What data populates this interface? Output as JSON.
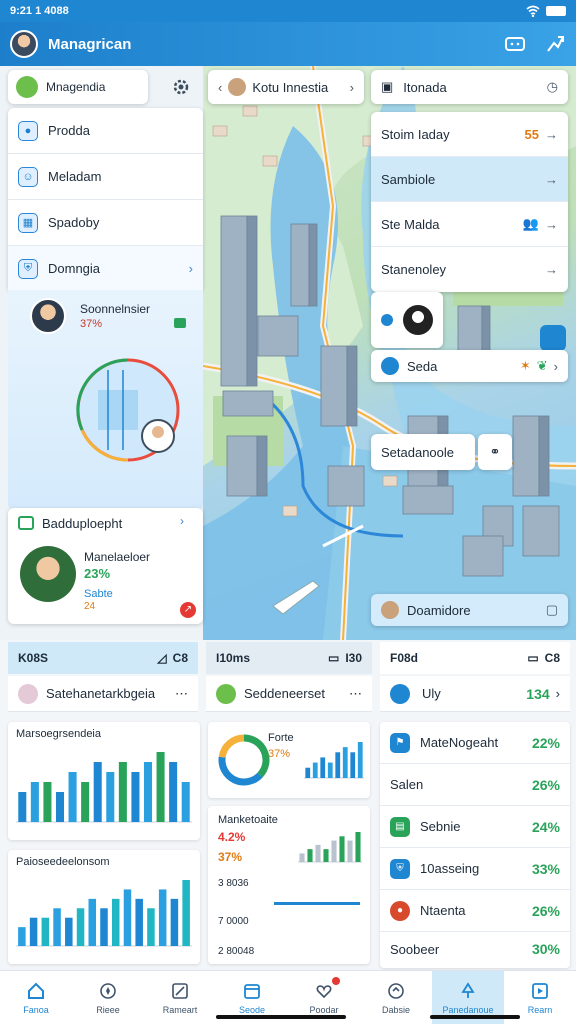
{
  "status": {
    "time": "9:21 1 4088",
    "battery_icon": "battery-icon",
    "wifi_icon": "wifi-icon"
  },
  "appbar": {
    "title": "Managrican",
    "actions": [
      "message-icon",
      "share-icon"
    ]
  },
  "left": {
    "header": "Mnagendia",
    "items": [
      {
        "label": "Prodda",
        "icon": "circle-icon"
      },
      {
        "label": "Meladam",
        "icon": "person-icon"
      },
      {
        "label": "Spadoby",
        "icon": "grid-icon"
      },
      {
        "label": "Domngia",
        "icon": "shield-icon"
      }
    ],
    "person": {
      "name": "Soonnelnsier",
      "stat": "37%"
    },
    "stat_card": {
      "title": "Badduploepht",
      "name": "Manelaeloer",
      "percent": "23%",
      "sub": "Sabte",
      "sub_value": "24"
    }
  },
  "map": {
    "tabs": {
      "left": "Kotu Innestia",
      "right": "Itonada"
    },
    "list": [
      {
        "label": "Stoim Iaday",
        "value": "55"
      },
      {
        "label": "Sambiole",
        "value": ""
      },
      {
        "label": "Ste Malda",
        "value": ""
      },
      {
        "label": "Stanenoley",
        "value": ""
      }
    ],
    "pin_card": {
      "label": "Seda"
    },
    "callout": {
      "label": "Setadanoole"
    },
    "bottom_card": {
      "label": "Doamidore"
    }
  },
  "bottom": {
    "tabs": [
      {
        "label": "K08S",
        "right": "C8"
      },
      {
        "label": "I10ms",
        "right": "I30"
      },
      {
        "label": "F08d",
        "right": "C8"
      }
    ],
    "subs": [
      {
        "label": "Satehanetarkbgeia"
      },
      {
        "label": "Seddeneerset"
      },
      {
        "label": "Uly",
        "value": "134"
      }
    ],
    "chart1": {
      "title": "Marsoegrsendeia"
    },
    "chart2": {
      "title": "Paioseedeelonsom"
    },
    "donut": {
      "title": "Forte",
      "percent": "37%"
    },
    "chart4": {
      "title": "Manketoaite",
      "v1": "4.2%",
      "v2": "37%",
      "r1": "3 8036",
      "r2": "7 0000",
      "r3": "2 80048"
    },
    "metrics": [
      {
        "label": "MateNogeaht",
        "value": "22%",
        "color": "#1f86d1"
      },
      {
        "label": "Salen",
        "value": "26%",
        "color": ""
      },
      {
        "label": "Sebnie",
        "value": "24%",
        "color": "#2aa35a"
      },
      {
        "label": "10asseing",
        "value": "33%",
        "color": "#1f86d1"
      },
      {
        "label": "Ntaenta",
        "value": "26%",
        "color": "#d84a2c"
      },
      {
        "label": "Soobeer",
        "value": "30%",
        "color": ""
      }
    ]
  },
  "nav": [
    {
      "label": "Fanoa",
      "icon": "home-icon"
    },
    {
      "label": "Rieee",
      "icon": "compass-icon"
    },
    {
      "label": "Rameart",
      "icon": "box-icon"
    },
    {
      "label": "Seode",
      "icon": "calendar-icon"
    },
    {
      "label": "Poodar",
      "icon": "heart-icon"
    },
    {
      "label": "Dabsie",
      "icon": "tag-icon"
    },
    {
      "label": "Panedanoue",
      "icon": "tree-icon"
    },
    {
      "label": "Rearn",
      "icon": "play-icon"
    }
  ],
  "chart_data": [
    {
      "type": "bar",
      "title": "Marsoegrsendeia",
      "values": [
        3,
        4,
        4,
        3,
        5,
        4,
        6,
        5,
        6,
        5,
        6,
        7,
        6,
        4
      ]
    },
    {
      "type": "bar",
      "title": "Paioseedeelonsom",
      "values": [
        2,
        3,
        3,
        4,
        3,
        4,
        5,
        4,
        5,
        6,
        5,
        4,
        6,
        5,
        7
      ]
    },
    {
      "type": "pie",
      "title": "Forte",
      "values": [
        37,
        40,
        23
      ]
    },
    {
      "type": "bar",
      "title": "Manketoaite",
      "values": [
        2,
        3,
        4,
        3,
        5,
        6,
        5,
        7
      ]
    }
  ]
}
